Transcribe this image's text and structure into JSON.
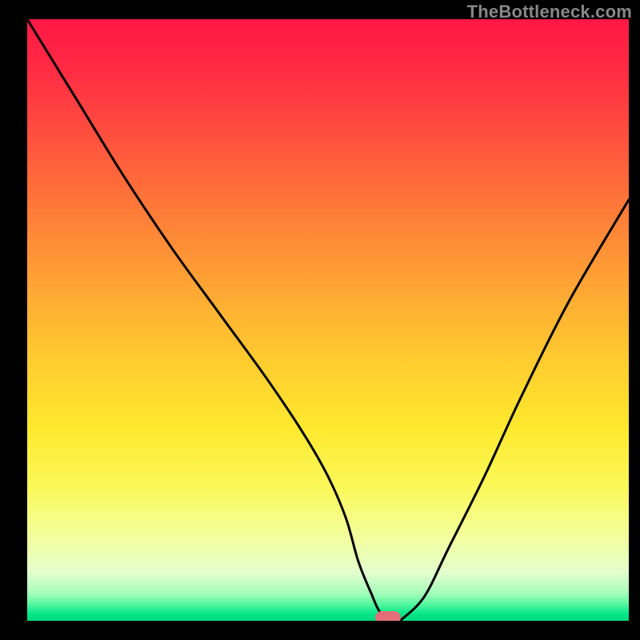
{
  "watermark": "TheBottleneck.com",
  "chart_data": {
    "type": "line",
    "title": "",
    "xlabel": "",
    "ylabel": "",
    "xlim": [
      0,
      100
    ],
    "ylim": [
      0,
      100
    ],
    "grid": false,
    "series": [
      {
        "name": "curve",
        "x": [
          0,
          8,
          16,
          24,
          32,
          40,
          46,
          50,
          53,
          55,
          57,
          59,
          62,
          66,
          70,
          76,
          82,
          90,
          100
        ],
        "y": [
          100,
          87,
          74,
          62,
          51,
          40,
          31,
          24,
          17,
          10,
          5,
          1,
          0,
          4,
          12,
          24,
          37,
          53,
          70
        ],
        "note": "Values estimated from pixels; x is horizontal fraction, y is height above bottom (0 at bottom, 100 at top)."
      }
    ],
    "marker": {
      "x": 60,
      "y": 0.5
    },
    "gradient_stops": [
      {
        "pos": 0,
        "color": "#ff1844"
      },
      {
        "pos": 50,
        "color": "#ffb132"
      },
      {
        "pos": 75,
        "color": "#fff02e"
      },
      {
        "pos": 96,
        "color": "#6df9a7"
      },
      {
        "pos": 100,
        "color": "#00d97f"
      }
    ]
  }
}
